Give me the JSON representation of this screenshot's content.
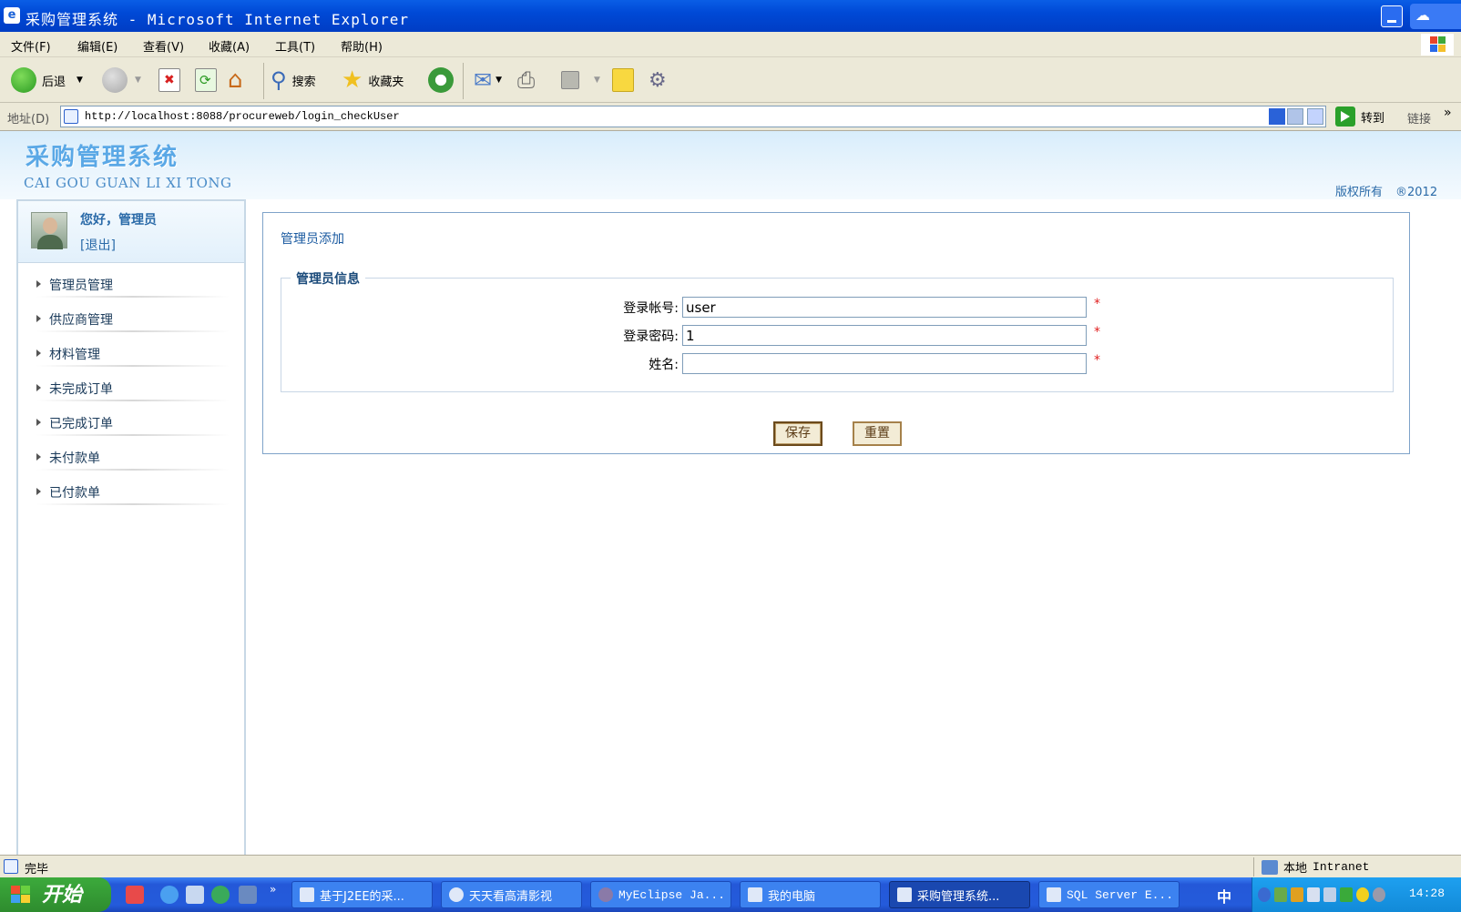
{
  "window": {
    "title": "采购管理系统 - Microsoft Internet Explorer",
    "menu": [
      "文件(F)",
      "编辑(E)",
      "查看(V)",
      "收藏(A)",
      "工具(T)",
      "帮助(H)"
    ]
  },
  "toolbar": {
    "back_label": "后退",
    "search_label": "搜索",
    "favorites_label": "收藏夹"
  },
  "address": {
    "label": "地址(D)",
    "url": "http://localhost:8088/procureweb/login_checkUser",
    "go_label": "转到",
    "links_label": "链接"
  },
  "page": {
    "logo_cn": "采购管理系统",
    "logo_en": "CAI GOU GUAN LI XI TONG",
    "copyright": "版权所有",
    "year": "®2012",
    "greeting": "您好，管理员",
    "logout": "[退出]",
    "nav": [
      "管理员管理",
      "供应商管理",
      "材料管理",
      "未完成订单",
      "已完成订单",
      "未付款单",
      "已付款单"
    ],
    "content_title": "管理员添加",
    "legend": "管理员信息",
    "form": {
      "account_label": "登录帐号:",
      "account_value": "user",
      "password_label": "登录密码:",
      "password_value": "1",
      "name_label": "姓名:",
      "name_value": "",
      "required_mark": "*"
    },
    "save_label": "保存",
    "reset_label": "重置"
  },
  "status": {
    "text": "完毕",
    "zone_cn": "本地",
    "zone_en": "Intranet"
  },
  "taskbar": {
    "start_label": "开始",
    "tasks": [
      "基于J2EE的采...",
      "天天看高清影视",
      "MyEclipse Ja...",
      "我的电脑",
      "采购管理系统...",
      "SQL Server E..."
    ],
    "active_task": "采购管理系统...",
    "ime": "中",
    "clock": "14:28"
  }
}
